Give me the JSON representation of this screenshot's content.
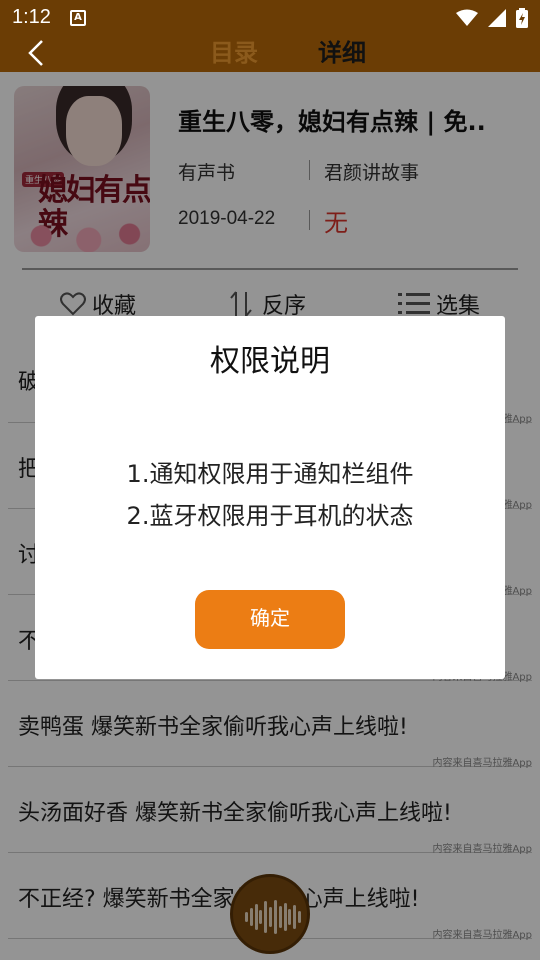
{
  "status_bar": {
    "time": "1:12",
    "notification_icon": "A"
  },
  "header": {
    "tabs": [
      {
        "label": "目录",
        "active": false
      },
      {
        "label": "详细",
        "active": true
      }
    ]
  },
  "book": {
    "cover_title": "媳妇有点辣",
    "cover_badge": "重生八零",
    "title": "重生八零，媳妇有点辣 | 免..",
    "type": "有声书",
    "author": "君颜讲故事",
    "date": "2019-04-22",
    "status": "无"
  },
  "actions": {
    "favorite": "收藏",
    "reverse": "反序",
    "select": "选集"
  },
  "episodes": [
    {
      "title": "破",
      "source": "内容来自喜马拉雅App"
    },
    {
      "title": "把",
      "source": "内容来自喜马拉雅App"
    },
    {
      "title": "讨",
      "source": "内容来自喜马拉雅App"
    },
    {
      "title": "不",
      "source": "内容来自喜马拉雅App"
    },
    {
      "title": "卖鸭蛋 爆笑新书全家偷听我心声上线啦!",
      "source": "内容来自喜马拉雅App"
    },
    {
      "title": "头汤面好香 爆笑新书全家偷听我心声上线啦!",
      "source": "内容来自喜马拉雅App"
    },
    {
      "title": "不正经? 爆笑新书全家偷听我心声上线啦!",
      "source": "内容来自喜马拉雅App"
    }
  ],
  "dialog": {
    "title": "权限说明",
    "line1": "1.通知权限用于通知栏组件",
    "line2": "2.蓝牙权限用于耳机的状态",
    "confirm": "确定"
  },
  "colors": {
    "header_bg": "#6b3d05",
    "accent": "#ec7d14",
    "status_red": "#d9342b"
  }
}
